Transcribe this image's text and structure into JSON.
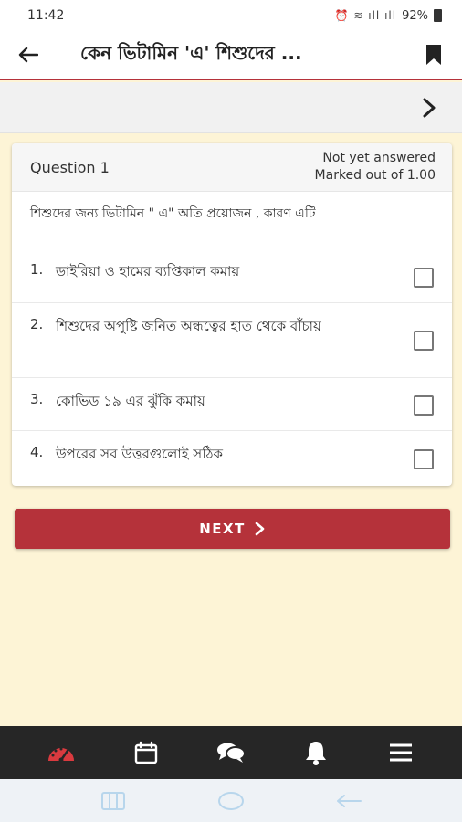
{
  "status_bar": {
    "time": "11:42",
    "icons": "⏰ ≋ ıll ıll",
    "battery": "92%"
  },
  "app_bar": {
    "title": "কেন ভিটামিন 'এ' শিশুদের ..."
  },
  "question": {
    "label": "Question 1",
    "status": "Not yet answered",
    "marks": "Marked out of 1.00",
    "text": "শিশুদের জন্য  ভিটামিন \" এ\" অতি প্রয়োজন , কারণ এটি",
    "options": [
      {
        "num": "1.",
        "text": "ডাইরিয়া ও হামের ব্যপ্তিকাল কমায়"
      },
      {
        "num": "2.",
        "text": "শিশুদের অপুষ্টি জনিত অন্ধত্বের  হাত থেকে বাঁচায়"
      },
      {
        "num": "3.",
        "text": "কোভিড ১৯ এর ঝুঁকি কমায়"
      },
      {
        "num": "4.",
        "text": "উপরের সব উত্তরগুলোই সঠিক"
      }
    ]
  },
  "next_button": {
    "label": "NEXT"
  },
  "bottom_nav": [
    "dashboard-icon",
    "calendar-icon",
    "chat-icon",
    "notification-bell-icon",
    "menu-icon"
  ],
  "colors": {
    "accent": "#b5323a",
    "background": "#fdf4d6",
    "nav": "#262626"
  }
}
